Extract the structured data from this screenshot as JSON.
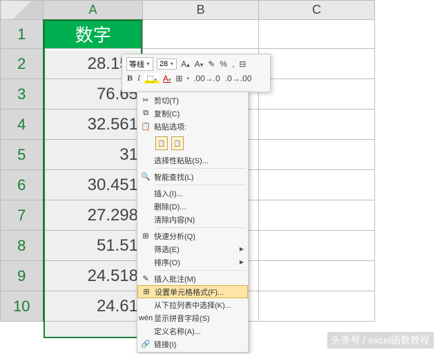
{
  "columns": [
    "A",
    "B",
    "C"
  ],
  "rows": [
    "1",
    "2",
    "3",
    "4",
    "5",
    "6",
    "7",
    "8",
    "9",
    "10"
  ],
  "header_cell": "数字",
  "cells": [
    "28.154",
    "76.65",
    "32.561",
    "31",
    "30.451",
    "27.298",
    "51.51",
    "24.518",
    "24.61"
  ],
  "mini_toolbar": {
    "font": "等线",
    "size": "28",
    "inc": "A",
    "dec": "A",
    "fmt_painter": "✎",
    "percent": "%",
    "comma": ",",
    "bold": "B",
    "italic": "I",
    "fontcolor": "A",
    "border": "⊞",
    "indent_dec": "≡",
    "indent_inc": "≡"
  },
  "menu": {
    "cut": "剪切(T)",
    "copy": "复制(C)",
    "paste_options": "粘贴选项:",
    "paste_special": "选择性粘贴(S)...",
    "smart_lookup": "智能查找(L)",
    "insert": "插入(I)...",
    "delete": "删除(D)...",
    "clear": "清除内容(N)",
    "quick_analysis": "快速分析(Q)",
    "filter": "筛选(E)",
    "sort": "排序(O)",
    "insert_comment": "插入批注(M)",
    "format_cells": "设置单元格格式(F)...",
    "pick_list": "从下拉列表中选择(K)...",
    "phonetic": "显示拼音字段(S)",
    "define_name": "定义名称(A)...",
    "hyperlink": "链接(I)"
  },
  "watermark": "头条号 / excel函数教程"
}
